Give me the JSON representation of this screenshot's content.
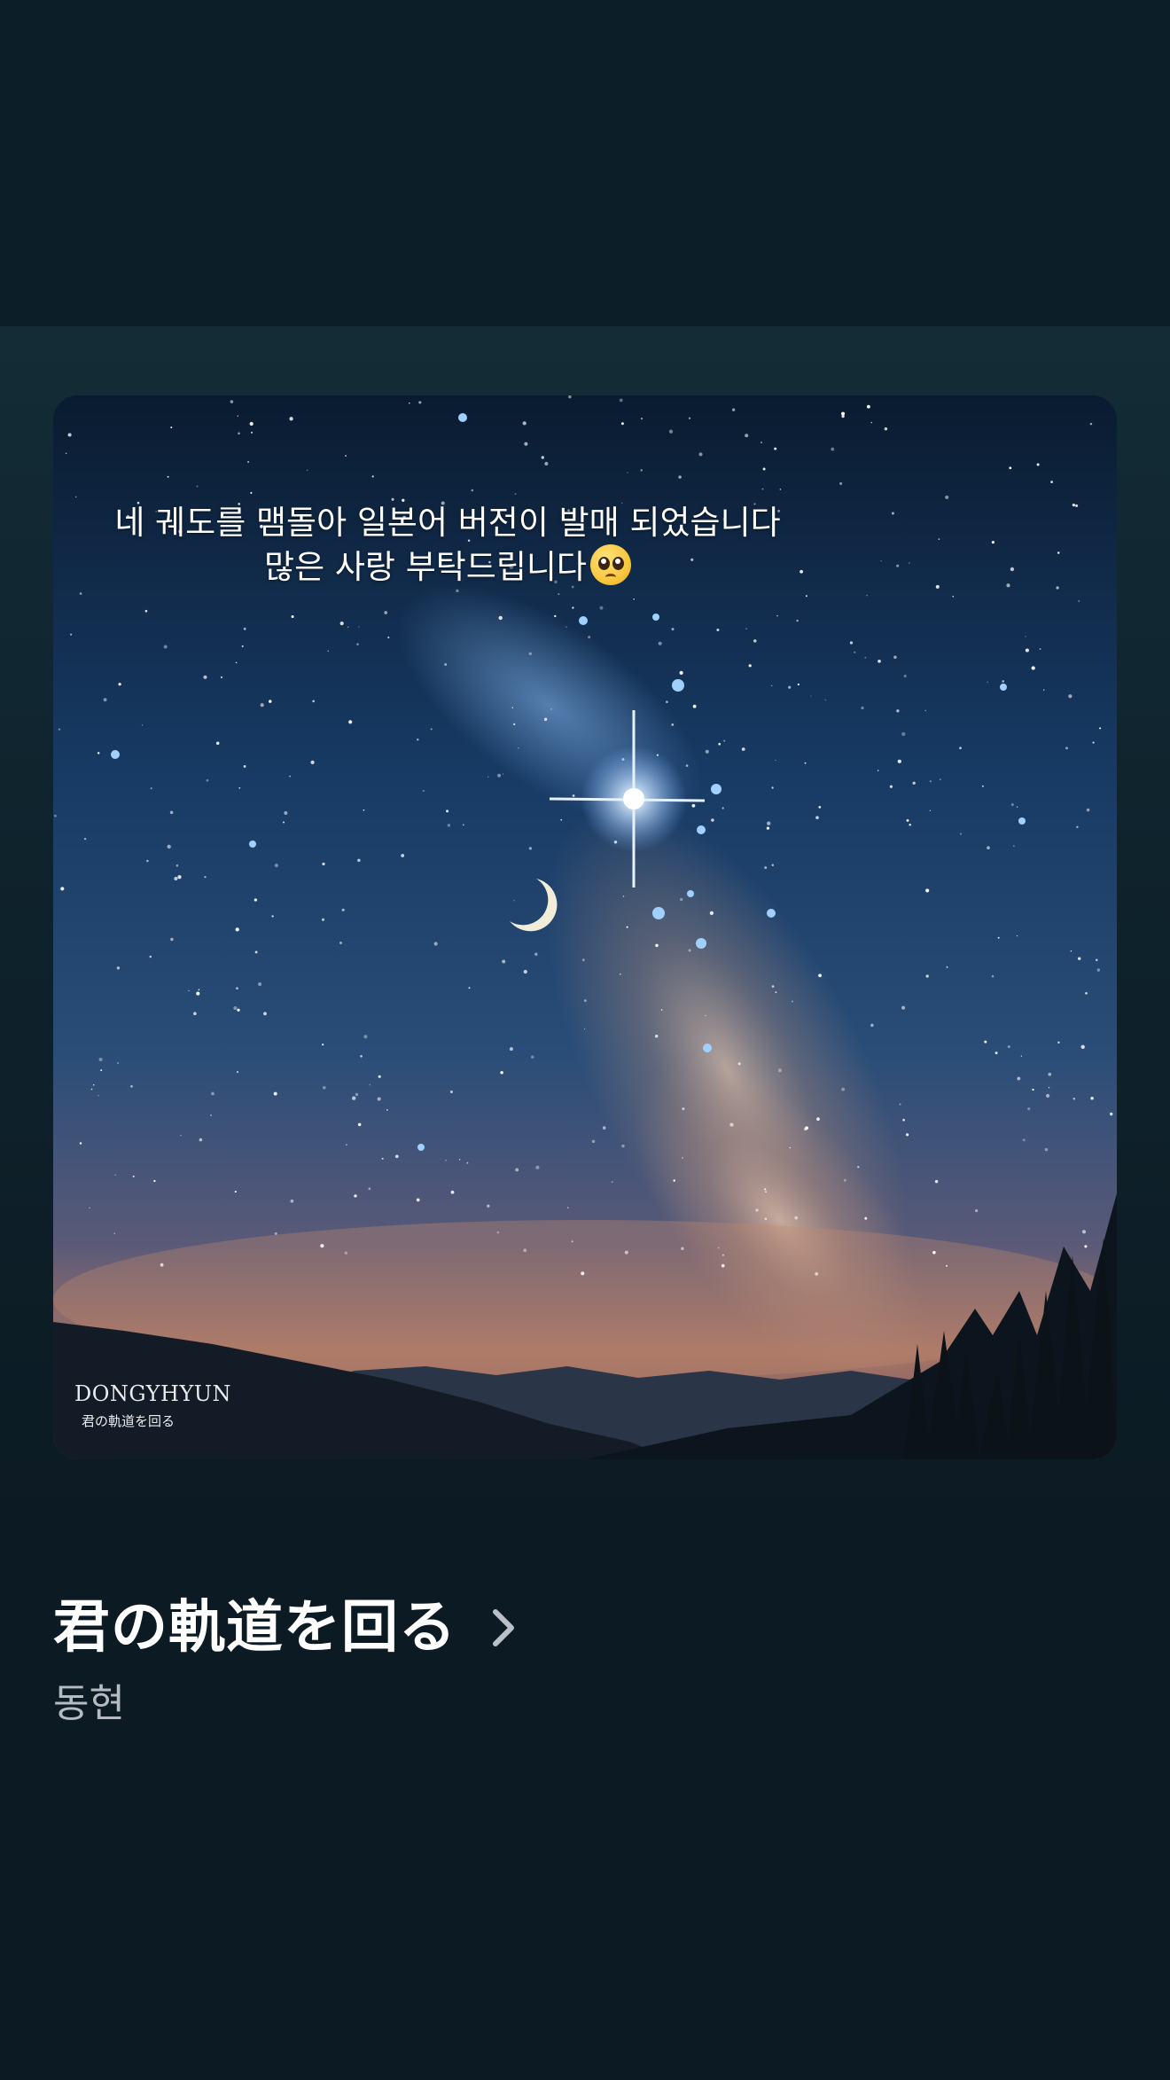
{
  "story": {
    "caption_line1": "네 궤도를 맴돌아 일본어 버전이 발매 되었습니다",
    "caption_line2": "많은 사랑 부탁드립니다",
    "emoji": "pleading-face-emoji",
    "artwork": {
      "watermark_title": "DONGYHYUN",
      "watermark_subtitle": "君の軌道を回る"
    }
  },
  "track": {
    "title": "君の軌道を回る",
    "artist": "동현",
    "chevron_icon": "chevron-right-icon"
  },
  "colors": {
    "background": "#0b1a23",
    "band": "#132c36",
    "title": "#ffffff",
    "artist": "#b4bcc2"
  }
}
